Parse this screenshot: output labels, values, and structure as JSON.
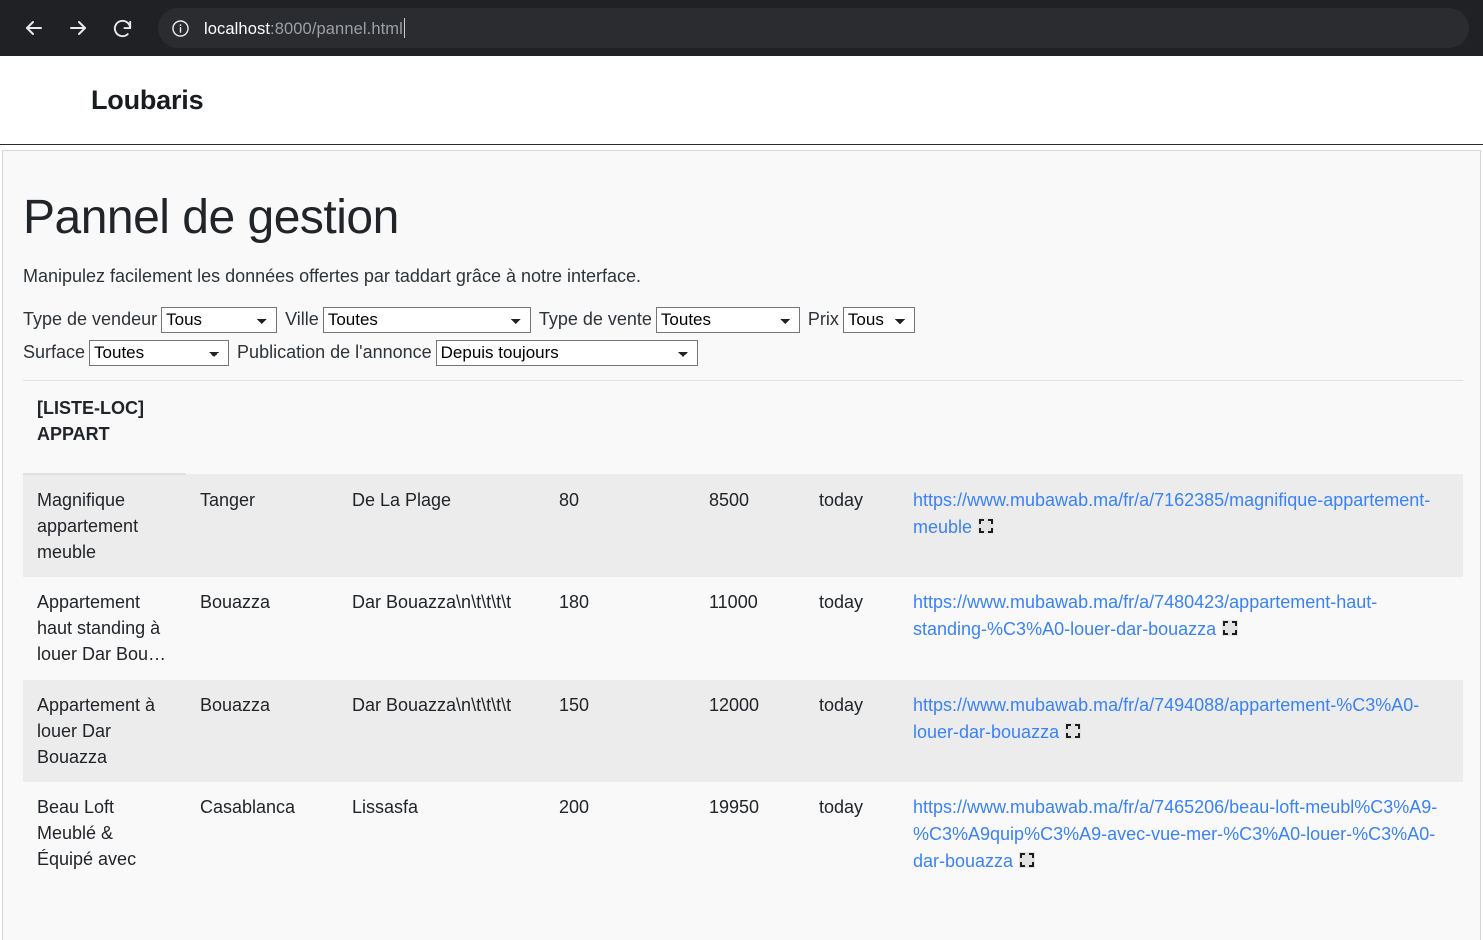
{
  "browser": {
    "back_icon": "arrow-left-icon",
    "forward_icon": "arrow-right-icon",
    "reload_icon": "reload-icon",
    "site_info_icon": "info-circle-icon",
    "url_host": "localhost",
    "url_rest": ":8000/pannel.html"
  },
  "header": {
    "brand": "Loubaris"
  },
  "main": {
    "title": "Pannel de gestion",
    "subtitle": "Manipulez facilement les données offertes par taddart grâce à notre interface."
  },
  "filters": {
    "row1": [
      {
        "label": "Type de vendeur",
        "value": "Tous",
        "size": "w-vendeur",
        "name": "filter-seller-type"
      },
      {
        "label": "Ville",
        "value": "Toutes",
        "size": "w-ville",
        "name": "filter-city"
      },
      {
        "label": "Type de vente",
        "value": "Toutes",
        "size": "w-vente",
        "name": "filter-sale-type"
      },
      {
        "label": "Prix",
        "value": "Tous",
        "size": "w-prix",
        "name": "filter-price"
      }
    ],
    "row2": [
      {
        "label": "Surface",
        "value": "Toutes",
        "size": "w-surface",
        "name": "filter-surface"
      },
      {
        "label": "Publication de l'annonce",
        "value": "Depuis toujours",
        "size": "w-pub",
        "name": "filter-publication-date"
      }
    ]
  },
  "table": {
    "header": "[LISTE-LOC] APPART",
    "rows": [
      {
        "title": "Magnifique appartement meuble",
        "ville": "Tanger",
        "quartier": "De La Plage",
        "surface": "80",
        "prix": "8500",
        "date": "today",
        "url": "https://www.mubawab.ma/fr/a/7162385/magnifique-appartement-meuble"
      },
      {
        "title": "Appartement haut standing à louer Dar Bou…",
        "ville": "Bouazza",
        "quartier": "Dar Bouazza\\n\\t\\t\\t\\t",
        "surface": "180",
        "prix": "11000",
        "date": "today",
        "url": "https://www.mubawab.ma/fr/a/7480423/appartement-haut-standing-%C3%A0-louer-dar-bouazza"
      },
      {
        "title": "Appartement à louer Dar Bouazza",
        "ville": "Bouazza",
        "quartier": "Dar Bouazza\\n\\t\\t\\t\\t",
        "surface": "150",
        "prix": "12000",
        "date": "today",
        "url": "https://www.mubawab.ma/fr/a/7494088/appartement-%C3%A0-louer-dar-bouazza"
      },
      {
        "title": "Beau Loft Meublé & Équipé avec",
        "ville": "Casablanca",
        "quartier": "Lissasfa",
        "surface": "200",
        "prix": "19950",
        "date": "today",
        "url": "https://www.mubawab.ma/fr/a/7465206/beau-loft-meubl%C3%A9-%C3%A9quip%C3%A9-avec-vue-mer-%C3%A0-louer-%C3%A0-dar-bouazza"
      }
    ],
    "link_icon": "expand-corners-icon"
  },
  "colors": {
    "chrome_bg": "#202124",
    "link": "#3b82f6",
    "page_bg": "#f9f9fa",
    "stripe": "#ececec"
  }
}
